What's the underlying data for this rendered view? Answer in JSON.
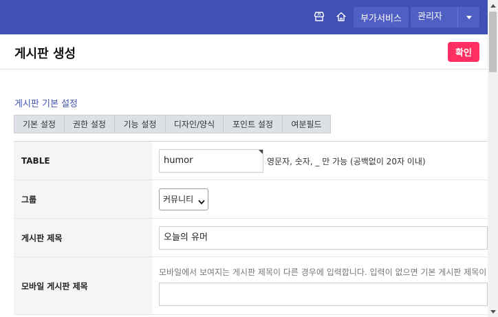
{
  "topbar": {
    "icons": [
      "shop-icon",
      "home-icon"
    ],
    "addon_label": "부가서비스",
    "admin_label": "관리자",
    "bg_color": "#3f51b5"
  },
  "header": {
    "title": "게시판 생성",
    "confirm_label": "확인",
    "confirm_color": "#ff3061"
  },
  "section": {
    "title": "게시판 기본 설정"
  },
  "tabs": [
    {
      "label": "기본 설정"
    },
    {
      "label": "권한 설정"
    },
    {
      "label": "기능 설정"
    },
    {
      "label": "디자인/양식"
    },
    {
      "label": "포인트 설정"
    },
    {
      "label": "여분필드"
    }
  ],
  "form": {
    "table": {
      "label": "TABLE",
      "value": "humor",
      "help": "영문자, 숫자, _ 만 가능 (공백없이 20자 이내)"
    },
    "group": {
      "label": "그룹",
      "selected": "커뮤니티"
    },
    "subject": {
      "label": "게시판 제목",
      "value": "오늘의 유머"
    },
    "mobile_subject": {
      "label": "모바일 게시판 제목",
      "help": "모바일에서 보여지는 게시판 제목이 다른 경우에 입력합니다. 입력이 없으면 기본 게시판 제목이 출력됩니다.",
      "value": ""
    }
  }
}
